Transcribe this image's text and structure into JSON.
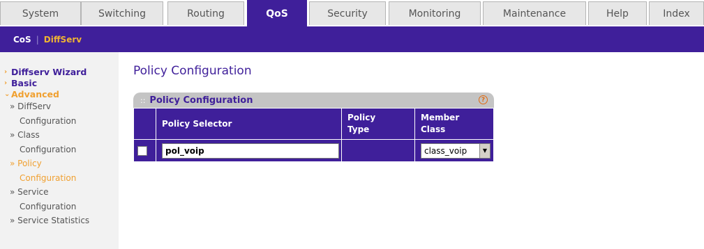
{
  "tabs": [
    {
      "label": "System",
      "active": false
    },
    {
      "label": "Switching",
      "active": false
    },
    {
      "label": "Routing",
      "active": false
    },
    {
      "label": "QoS",
      "active": true
    },
    {
      "label": "Security",
      "active": false
    },
    {
      "label": "Monitoring",
      "active": false
    },
    {
      "label": "Maintenance",
      "active": false
    },
    {
      "label": "Help",
      "active": false
    },
    {
      "label": "Index",
      "active": false
    }
  ],
  "subnav": {
    "cos": "CoS",
    "separator": "|",
    "diffserv": "DiffServ"
  },
  "sidebar": {
    "diffserv_wizard": "Diffserv Wizard",
    "basic": "Basic",
    "advanced": "Advanced",
    "items": [
      {
        "line1": "» DiffServ",
        "line2": "Configuration"
      },
      {
        "line1": "» Class",
        "line2": "Configuration"
      },
      {
        "line1": "» Policy",
        "line2": "Configuration"
      },
      {
        "line1": "» Service",
        "line2": "Configuration"
      },
      {
        "line1": "» Service Statistics",
        "line2": ""
      }
    ]
  },
  "page": {
    "title": "Policy Configuration"
  },
  "panel": {
    "title": "Policy Configuration",
    "help": "?",
    "columns": {
      "policy_selector": "Policy Selector",
      "policy_type_1": "Policy",
      "policy_type_2": "Type",
      "member_class_1": "Member",
      "member_class_2": "Class"
    },
    "row": {
      "policy_selector_value": "pol_voip",
      "policy_type": "",
      "member_class": "class_voip"
    }
  },
  "colors": {
    "accent": "#3f1f9a",
    "highlight": "#f0a030"
  }
}
